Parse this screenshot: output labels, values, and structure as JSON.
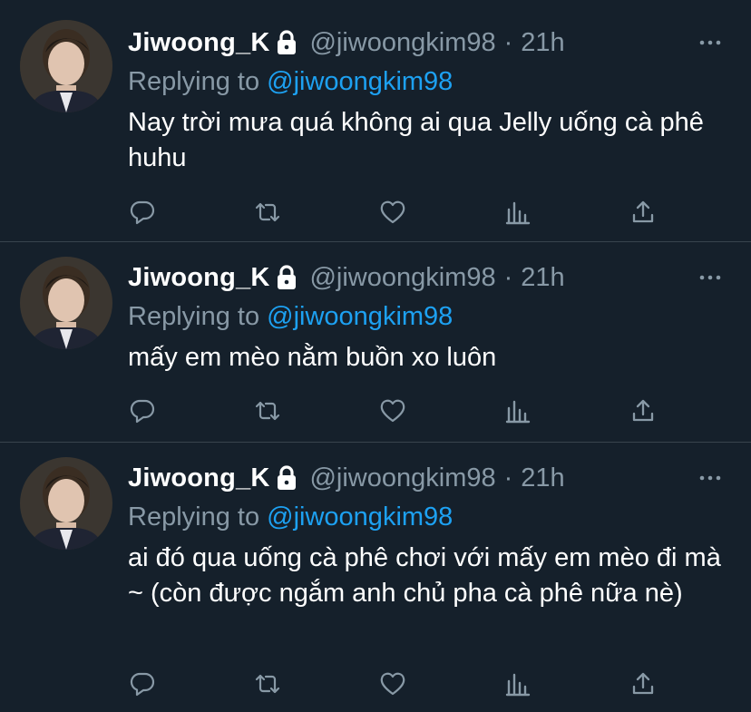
{
  "tweets": [
    {
      "display_name": "Jiwoong_K",
      "handle": "@jiwoongkim98",
      "separator": "·",
      "time": "21h",
      "reply_prefix": "Replying to",
      "reply_to": "@jiwoongkim98",
      "text": "Nay trời mưa quá không ai qua Jelly uống cà phê huhu"
    },
    {
      "display_name": "Jiwoong_K",
      "handle": "@jiwoongkim98",
      "separator": "·",
      "time": "21h",
      "reply_prefix": "Replying to",
      "reply_to": "@jiwoongkim98",
      "text": "mấy em mèo nằm buồn xo luôn"
    },
    {
      "display_name": "Jiwoong_K",
      "handle": "@jiwoongkim98",
      "separator": "·",
      "time": "21h",
      "reply_prefix": "Replying to",
      "reply_to": "@jiwoongkim98",
      "text": "ai đó qua uống cà phê chơi với mấy em mèo đi mà ~ (còn được ngắm anh chủ pha cà phê nữa nè)"
    }
  ],
  "icons": {
    "lock": "lock-icon",
    "more": "more-icon",
    "reply": "reply-icon",
    "retweet": "retweet-icon",
    "like": "heart-icon",
    "stats": "analytics-icon",
    "share": "share-icon"
  },
  "colors": {
    "background": "#15202b",
    "divider": "#38444d",
    "secondary_text": "#8899a6",
    "link": "#1da1f2",
    "primary_text": "#ffffff"
  }
}
